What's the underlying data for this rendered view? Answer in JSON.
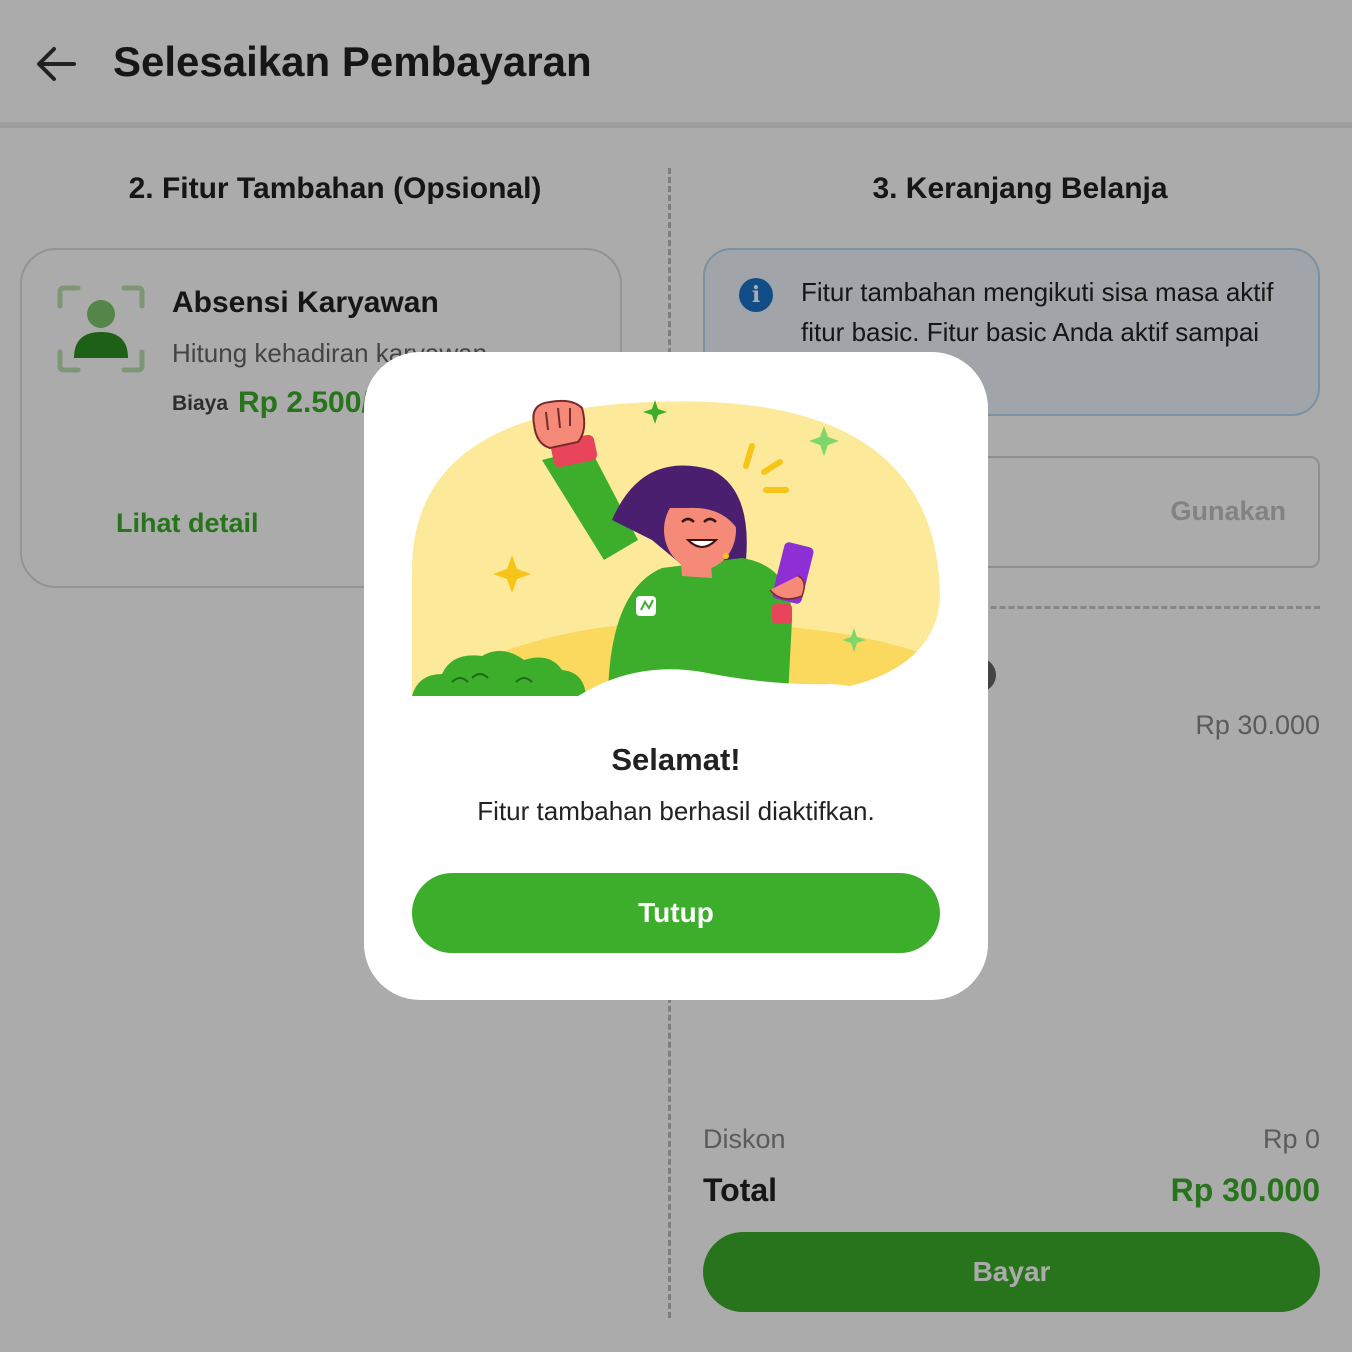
{
  "header": {
    "title": "Selesaikan Pembayaran",
    "back_icon": "arrow-left-icon"
  },
  "sections": {
    "additional_features_title": "2. Fitur Tambahan (Opsional)",
    "cart_title": "3. Keranjang Belanja"
  },
  "feature": {
    "name": "Absensi Karyawan",
    "description": "Hitung kehadiran karyawan",
    "cost_label": "Biaya",
    "price": "Rp 2.500/",
    "detail_link": "Lihat detail",
    "icon": "employee-attendance-icon"
  },
  "cart": {
    "info_text": "Fitur tambahan mengikuti sisa masa aktif fitur basic. Fitur basic Anda aktif sampai",
    "voucher_apply": "Gunakan",
    "item_price": "Rp 30.000",
    "discount_label": "Diskon",
    "discount_value": "Rp 0",
    "total_label": "Total",
    "total_value": "Rp 30.000",
    "pay_button": "Bayar"
  },
  "modal": {
    "title": "Selamat!",
    "message": "Fitur tambahan berhasil diaktifkan.",
    "close_button": "Tutup",
    "illustration": "celebrating-woman-illustration"
  },
  "colors": {
    "brand_green": "#3dae2b",
    "info_blue": "#1a73c9",
    "overlay": "rgba(0,0,0,0.33)"
  }
}
